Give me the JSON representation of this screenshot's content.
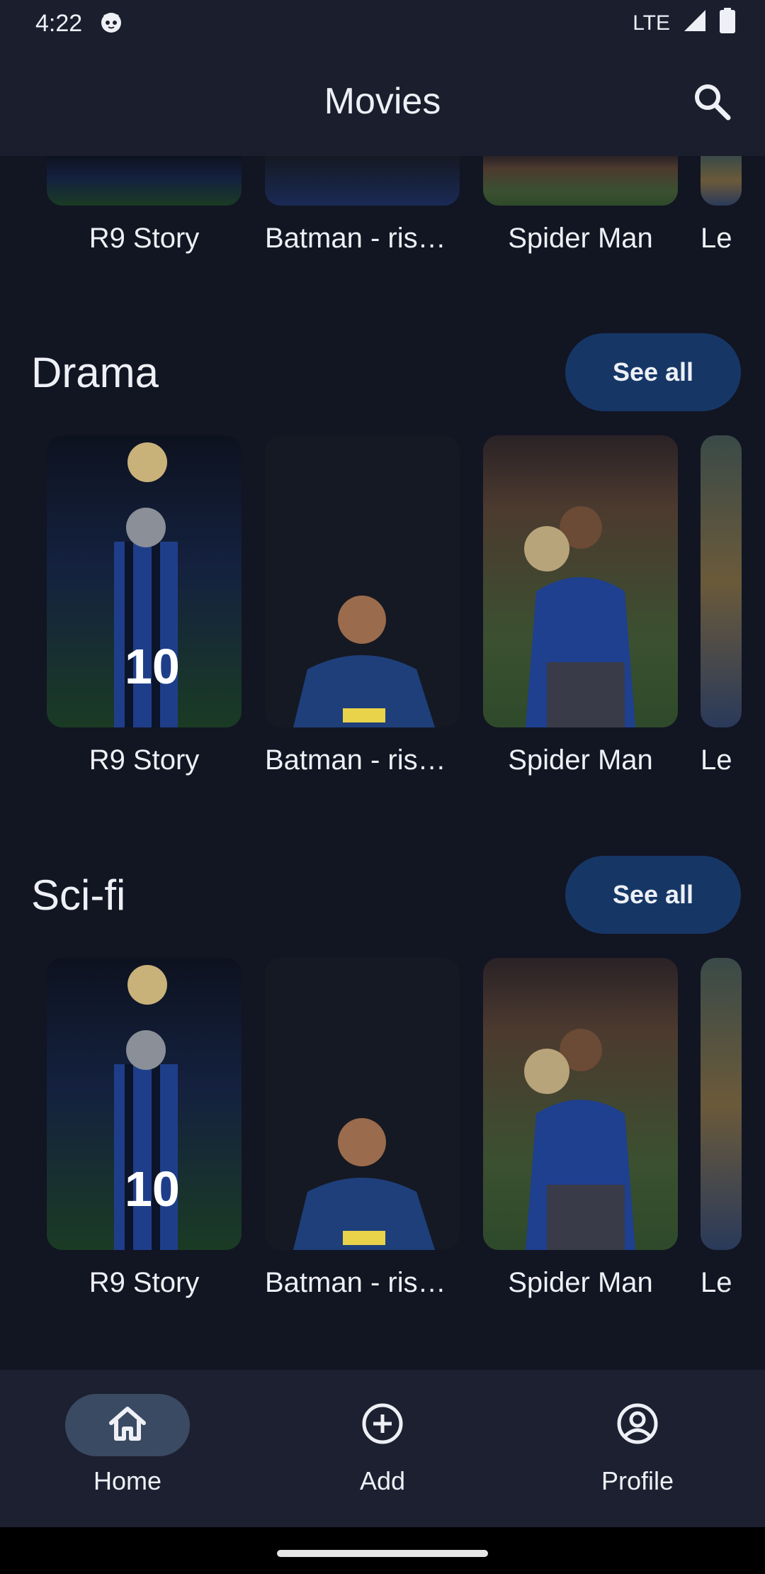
{
  "status_bar": {
    "time": "4:22",
    "network": "LTE"
  },
  "app_bar": {
    "title": "Movies"
  },
  "top_row_cards": [
    {
      "title": "R9 Story"
    },
    {
      "title": "Batman - rise of the Joker"
    },
    {
      "title": "Spider Man"
    },
    {
      "title": "Le"
    }
  ],
  "sections": [
    {
      "title": "Drama",
      "see_all_label": "See all",
      "cards": [
        {
          "title": "R9 Story"
        },
        {
          "title": "Batman - rise of the Joker"
        },
        {
          "title": "Spider Man"
        },
        {
          "title": "Le"
        }
      ]
    },
    {
      "title": "Sci-fi",
      "see_all_label": "See all",
      "cards": [
        {
          "title": "R9 Story"
        },
        {
          "title": "Batman - rise of the Joker"
        },
        {
          "title": "Spider Man"
        },
        {
          "title": "Le"
        }
      ]
    }
  ],
  "bottom_nav": {
    "items": [
      {
        "label": "Home",
        "icon": "home-icon",
        "active": true
      },
      {
        "label": "Add",
        "icon": "add-circle-icon",
        "active": false
      },
      {
        "label": "Profile",
        "icon": "profile-icon",
        "active": false
      }
    ]
  },
  "colors": {
    "background": "#121522",
    "app_bar": "#1a1e2d",
    "button": "#163766",
    "nav_bar": "#1c2030",
    "nav_active_pill": "#3b4a63"
  }
}
